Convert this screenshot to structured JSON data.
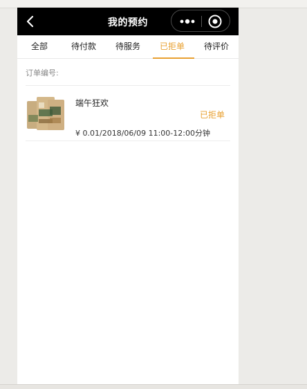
{
  "navbar": {
    "title": "我的预约",
    "back_icon": "chevron-left-icon",
    "more_icon": "more-dots-icon",
    "close_icon": "target-circle-icon"
  },
  "tabs": [
    {
      "label": "全部",
      "active": false
    },
    {
      "label": "待付款",
      "active": false
    },
    {
      "label": "待服务",
      "active": false
    },
    {
      "label": "已拒单",
      "active": true
    },
    {
      "label": "待评价",
      "active": false
    }
  ],
  "order": {
    "number_label": "订单编号:",
    "item_title": "端午狂欢",
    "status": "已拒单",
    "meta": "¥ 0.01/2018/06/09 11:00-12:00分钟",
    "thumbnail_icon": "product-package-image"
  },
  "colors": {
    "accent": "#e8a030",
    "navbar_bg": "#000000"
  }
}
